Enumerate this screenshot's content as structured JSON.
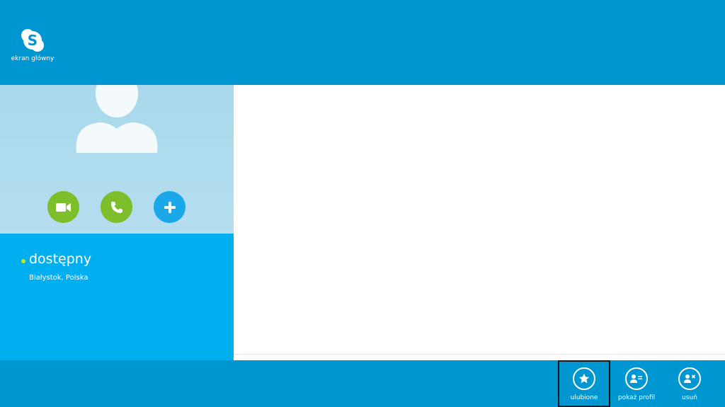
{
  "header": {
    "home_label": "ekran główny",
    "home_icon": "skype-logo-icon"
  },
  "profile": {
    "status": "dostępny",
    "status_color": "#c6e61a",
    "location": "Białystok, Polska",
    "actions": [
      {
        "name": "video-call",
        "icon": "video-camera-icon",
        "color": "#7cbf2a"
      },
      {
        "name": "voice-call",
        "icon": "phone-icon",
        "color": "#7cbf2a"
      },
      {
        "name": "add",
        "icon": "plus-icon",
        "color": "#1ba8e8"
      }
    ]
  },
  "appbar": {
    "favorites_label": "ulubione",
    "show_profile_label": "pokaż profil",
    "remove_label": "usuń"
  },
  "colors": {
    "header": "#0096d2",
    "info_panel": "#00aff0",
    "photo_bg": "#afdcee"
  }
}
